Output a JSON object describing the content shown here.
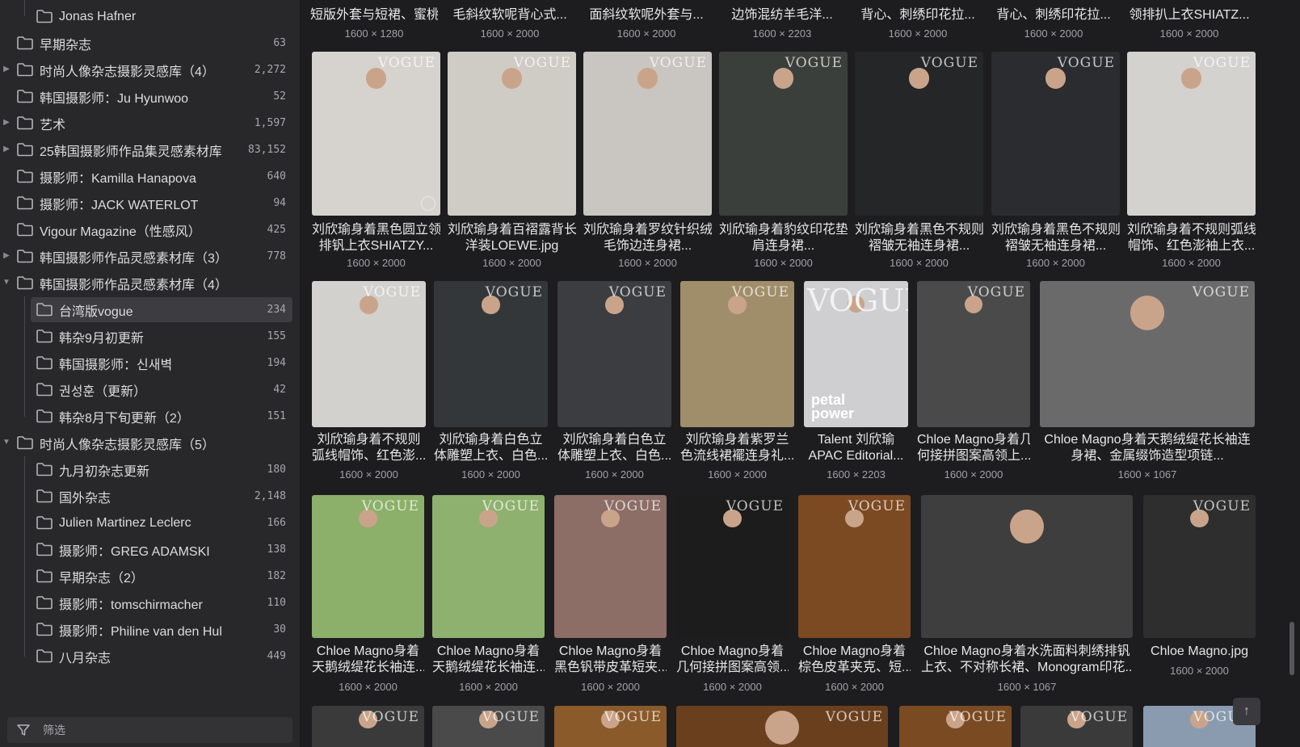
{
  "sidebar": {
    "rows": [
      {
        "label": "Jonas Hafner",
        "count": "",
        "level": 1,
        "arrow": "",
        "guide": true
      },
      {
        "label": "早期杂志",
        "count": "63",
        "level": 0,
        "arrow": ""
      },
      {
        "label": "时尚人像杂志摄影灵感库（4）",
        "count": "2,272",
        "level": 0,
        "arrow": "right"
      },
      {
        "label": "韩国摄影师：Ju Hyunwoo",
        "count": "52",
        "level": 0,
        "arrow": ""
      },
      {
        "label": "艺术",
        "count": "1,597",
        "level": 0,
        "arrow": "right"
      },
      {
        "label": "25韩国摄影师作品集灵感素材库",
        "count": "83,152",
        "level": 0,
        "arrow": "right"
      },
      {
        "label": "摄影师：Kamilla Hanapova",
        "count": "640",
        "level": 0,
        "arrow": ""
      },
      {
        "label": "摄影师：JACK WATERLOT",
        "count": "94",
        "level": 0,
        "arrow": ""
      },
      {
        "label": "Vigour Magazine（性感风）",
        "count": "425",
        "level": 0,
        "arrow": ""
      },
      {
        "label": "韩国摄影师作品灵感素材库（3）",
        "count": "778",
        "level": 0,
        "arrow": "right"
      },
      {
        "label": "韩国摄影师作品灵感素材库（4）",
        "count": "",
        "level": 0,
        "arrow": "down"
      },
      {
        "label": "台湾版vogue",
        "count": "234",
        "level": 1,
        "arrow": "",
        "selected": true
      },
      {
        "label": "韩杂9月初更新",
        "count": "155",
        "level": 1,
        "arrow": ""
      },
      {
        "label": "韩国摄影师：신새벽",
        "count": "194",
        "level": 1,
        "arrow": ""
      },
      {
        "label": "권성훈（更新）",
        "count": "42",
        "level": 1,
        "arrow": ""
      },
      {
        "label": "韩杂8月下旬更新（2）",
        "count": "151",
        "level": 1,
        "arrow": ""
      },
      {
        "label": "时尚人像杂志摄影灵感库（5）",
        "count": "",
        "level": 0,
        "arrow": "down"
      },
      {
        "label": "九月初杂志更新",
        "count": "180",
        "level": 1,
        "arrow": ""
      },
      {
        "label": "国外杂志",
        "count": "2,148",
        "level": 1,
        "arrow": ""
      },
      {
        "label": "Julien Martinez Leclerc",
        "count": "166",
        "level": 1,
        "arrow": ""
      },
      {
        "label": "摄影师：GREG ADAMSKI",
        "count": "138",
        "level": 1,
        "arrow": ""
      },
      {
        "label": "早期杂志（2）",
        "count": "182",
        "level": 1,
        "arrow": ""
      },
      {
        "label": "摄影师：tomschirmacher",
        "count": "110",
        "level": 1,
        "arrow": ""
      },
      {
        "label": "摄影师：Philine van den Hul",
        "count": "30",
        "level": 1,
        "arrow": ""
      },
      {
        "label": "八月杂志",
        "count": "449",
        "level": 1,
        "arrow": ""
      }
    ],
    "filter_label": "筛选",
    "filter_icon": "filter-icon",
    "folder_icon": "folder-icon"
  },
  "grid": {
    "row0": [
      {
        "title": "短版外套与短裙、蜜桃造型金...",
        "dims": "1600 × 1280"
      },
      {
        "title": "毛斜纹软呢背心式...",
        "dims": "1600 × 2000"
      },
      {
        "title": "面斜纹软呢外套与...",
        "dims": "1600 × 2000"
      },
      {
        "title": "边饰混纺羊毛洋...",
        "dims": "1600 × 2203"
      },
      {
        "title": "背心、刺绣印花拉...",
        "dims": "1600 × 2000"
      },
      {
        "title": "背心、刺绣印花拉...",
        "dims": "1600 × 2000"
      },
      {
        "title": "领排扒上衣SHIATZ...",
        "dims": "1600 × 2000"
      }
    ],
    "row1": [
      {
        "line1": "刘欣瑜身着黑色圆立领",
        "line2": "排钒上衣SHIATZY...",
        "dims": "1600 × 2000",
        "bg": "#d6d3cf",
        "accent": "#1a1a1a",
        "badge": "VOGUE"
      },
      {
        "line1": "刘欣瑜身着百褶露背长",
        "line2": "洋装LOEWE.jpg",
        "dims": "1600 × 2000",
        "bg": "#cfcbc5",
        "accent": "#2e3328",
        "badge": "VOGUE"
      },
      {
        "line1": "刘欣瑜身着罗纹针织绒",
        "line2": "毛饰边连身裙...",
        "dims": "1600 × 2000",
        "bg": "#c9c5c0",
        "accent": "#8c5c4c",
        "badge": "VOGUE"
      },
      {
        "line1": "刘欣瑜身着豹纹印花垫",
        "line2": "肩连身裙...",
        "dims": "1600 × 2000",
        "bg": "#3a3f3c",
        "accent": "#5a6e4a",
        "badge": "VOGUE"
      },
      {
        "line1": "刘欣瑜身着黑色不规则",
        "line2": "褶皱无袖连身裙...",
        "dims": "1600 × 2000",
        "bg": "#242628",
        "accent": "#0c0c0d",
        "badge": "VOGUE"
      },
      {
        "line1": "刘欣瑜身着黑色不规则",
        "line2": "褶皱无袖连身裙...",
        "dims": "1600 × 2000",
        "bg": "#2a2c2f",
        "accent": "#0d0d0e",
        "badge": "VOGUE"
      },
      {
        "line1": "刘欣瑜身着不规则弧线",
        "line2": "帽饰、红色澎袖上衣...",
        "dims": "1600 × 2000",
        "bg": "#d4d2cf",
        "accent": "#b8491c",
        "badge": "VOGUE"
      }
    ],
    "row2": [
      {
        "line1": "刘欣瑜身着不规则",
        "line2": "弧线帽饰、红色澎...",
        "dims": "1600 × 2000",
        "bg": "#d3d1ce",
        "accent": "#b8491c",
        "badge": "VOGUE"
      },
      {
        "line1": "刘欣瑜身着白色立",
        "line2": "体雕塑上衣、白色...",
        "dims": "1600 × 2000",
        "bg": "#34373a",
        "accent": "#c6cbcf",
        "badge": "VOGUE"
      },
      {
        "line1": "刘欣瑜身着白色立",
        "line2": "体雕塑上衣、白色...",
        "dims": "1600 × 2000",
        "bg": "#3b3d40",
        "accent": "#cdd0d3",
        "badge": "VOGUE"
      },
      {
        "line1": "刘欣瑜身着紫罗兰",
        "line2": "色流线裙襬连身礼...",
        "dims": "1600 × 2000",
        "bg": "#a08e6a",
        "accent": "#9d8cb0",
        "badge": "VOGUE"
      },
      {
        "line1": "Talent 刘欣瑜",
        "line2": "APAC Editorial...",
        "dims": "1600 × 2203",
        "bg": "#cfcfd2",
        "accent": "#141414",
        "badge": "VOGUE",
        "cover": true,
        "petal": "petal\npower"
      },
      {
        "line1": "Chloe Magno身着几",
        "line2": "何接拼图案高领上...",
        "dims": "1600 × 2000",
        "bg": "#4a4a4a",
        "accent": "#0f0f0f",
        "badge": "VOGUE"
      },
      {
        "line1": "Chloe Magno身着天鹅绒缇花长袖连",
        "line2": "身裙、金属缀饰造型项链...",
        "dims": "1600 × 1067",
        "bg": "#6a6a6a",
        "accent": "#1b1b1b",
        "badge": "VOGUE"
      }
    ],
    "row3": [
      {
        "line1": "Chloe Magno身着",
        "line2": "天鹅绒缇花长袖连...",
        "dims": "1600 × 2000",
        "bg": "#8cb06a",
        "accent": "#b8321f",
        "badge": "VOGUE"
      },
      {
        "line1": "Chloe Magno身着",
        "line2": "天鹅绒缇花长袖连...",
        "dims": "1600 × 2000",
        "bg": "#8fb170",
        "accent": "#b12f1d",
        "badge": "VOGUE"
      },
      {
        "line1": "Chloe Magno身着",
        "line2": "黑色钒带皮革短夹...",
        "dims": "1600 × 2000",
        "bg": "#8c6e66",
        "accent": "#3a6e8e",
        "badge": "VOGUE"
      },
      {
        "line1": "Chloe Magno身着",
        "line2": "几何接拼图案高领...",
        "dims": "1600 × 2000",
        "bg": "#1c1c1c",
        "accent": "#7fb06a",
        "badge": "VOGUE"
      },
      {
        "line1": "Chloe Magno身着",
        "line2": "棕色皮革夹克、短...",
        "dims": "1600 × 2000",
        "bg": "#7c4a22",
        "accent": "#c88a3a",
        "badge": "VOGUE"
      },
      {
        "line1": "Chloe Magno身着水洗面料刺绣排钒",
        "line2": "上衣、不对称长裙、Monogram印花...",
        "dims": "1600 × 1067",
        "bg": "#3e3e3e",
        "accent": "#cfcfcf",
        "badge": ""
      },
      {
        "line1": "Chloe Magno.jpg",
        "line2": "",
        "dims": "1600 × 2000",
        "bg": "#2e2e2e",
        "accent": "#5c5c5c",
        "badge": "VOGUE"
      }
    ],
    "row4": [
      {
        "bg": "#3a3a3a",
        "accent": "#777",
        "badge": "VOGUE"
      },
      {
        "bg": "#4a4a4a",
        "accent": "#1c1c1c",
        "badge": "VOGUE"
      },
      {
        "bg": "#8a5a2a",
        "accent": "#c8843a",
        "badge": "VOGUE"
      },
      {
        "bg": "#6a3f1e",
        "accent": "#c88a3a",
        "badge": "VOGUE"
      },
      {
        "bg": "#7a4a22",
        "accent": "#c0823a",
        "badge": "VOGUE"
      },
      {
        "bg": "#3a3a3a",
        "accent": "#9a9a9a",
        "badge": "VOGUE"
      },
      {
        "bg": "#8a9bb0",
        "accent": "#1e2b3a",
        "badge": "VOGUE"
      }
    ]
  },
  "scroll_top_icon": "arrow-up-icon",
  "colors": {
    "bg": "#1d1d20",
    "sidebar": "#28282b",
    "selected": "#3c3c41",
    "text": "#dcdcdc",
    "muted": "#a2a2a6"
  }
}
